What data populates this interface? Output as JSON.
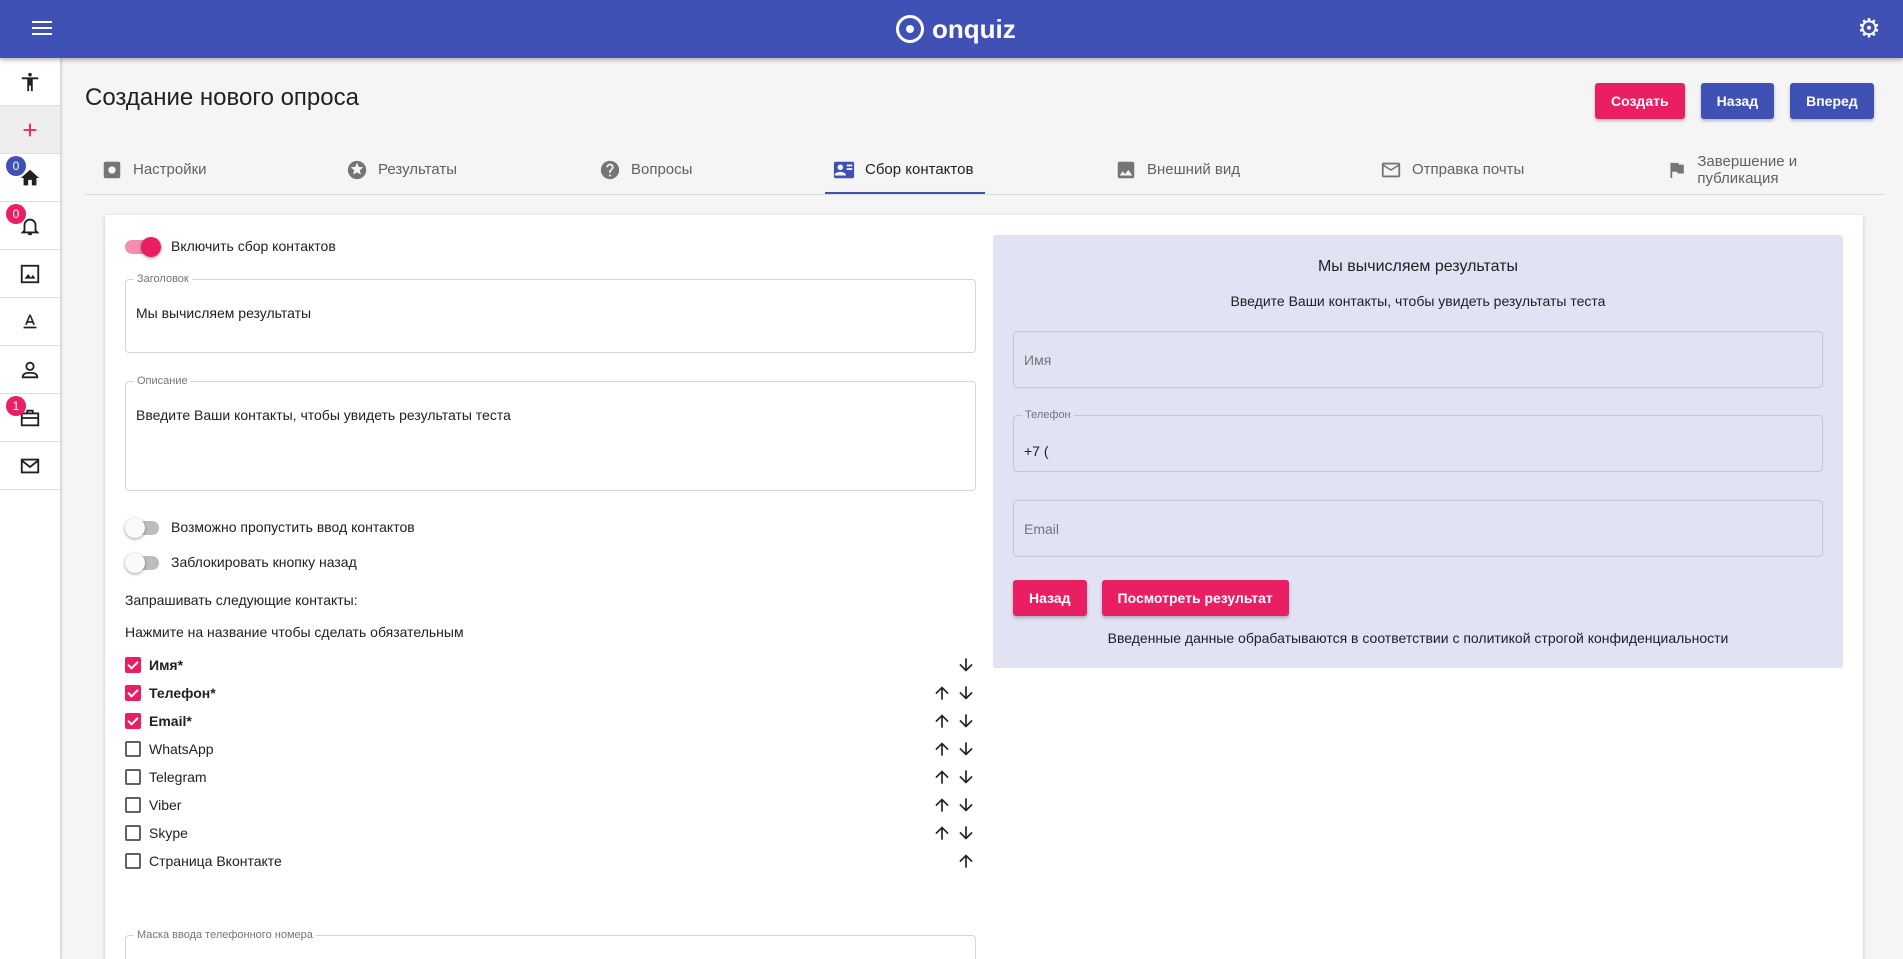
{
  "app": {
    "logo_text": "onquiz"
  },
  "header": {
    "title": "Создание нового опроса",
    "actions": {
      "create": "Создать",
      "back": "Назад",
      "forward": "Вперед"
    }
  },
  "sidebar": {
    "badges": {
      "home": "0",
      "notifications": "0",
      "portfolio": "1"
    }
  },
  "tabs": [
    {
      "label": "Настройки",
      "icon": "settings-icon"
    },
    {
      "label": "Результаты",
      "icon": "star-icon"
    },
    {
      "label": "Вопросы",
      "icon": "help-icon"
    },
    {
      "label": "Сбор контактов",
      "icon": "contact-card-icon"
    },
    {
      "label": "Внешний вид",
      "icon": "image-icon"
    },
    {
      "label": "Отправка почты",
      "icon": "mail-icon"
    },
    {
      "label": "Завершение и публикация",
      "icon": "flag-icon"
    }
  ],
  "form": {
    "enable_label": "Включить сбор контактов",
    "title_field": {
      "label": "Заголовок",
      "value": "Мы вычисляем результаты"
    },
    "description_field": {
      "label": "Описание",
      "value": "Введите Ваши контакты, чтобы увидеть результаты теста"
    },
    "skip_label": "Возможно пропустить ввод контактов",
    "block_back_label": "Заблокировать кнопку назад",
    "request_heading": "Запрашивать следующие контакты:",
    "request_hint": "Нажмите на название чтобы сделать обязательным",
    "contacts": [
      {
        "label": "Имя*",
        "checked": true
      },
      {
        "label": "Телефон*",
        "checked": true
      },
      {
        "label": "Email*",
        "checked": true
      },
      {
        "label": "WhatsApp",
        "checked": false
      },
      {
        "label": "Telegram",
        "checked": false
      },
      {
        "label": "Viber",
        "checked": false
      },
      {
        "label": "Skype",
        "checked": false
      },
      {
        "label": "Страница Вконтакте",
        "checked": false
      }
    ],
    "mask_field": {
      "label": "Маска ввода телефонного номера"
    }
  },
  "preview": {
    "title": "Мы вычисляем результаты",
    "description": "Введите Ваши контакты, чтобы увидеть результаты теста",
    "name_placeholder": "Имя",
    "phone_label": "Телефон",
    "phone_value": "+7 (",
    "email_placeholder": "Email",
    "back_button": "Назад",
    "view_button": "Посмотреть результат",
    "privacy": "Введенные данные обрабатываются в соответствии с политикой строгой конфиденциальности"
  },
  "colors": {
    "primary": "#3f51b5",
    "accent": "#e91e63",
    "preview_bg": "#e1e2f3"
  }
}
